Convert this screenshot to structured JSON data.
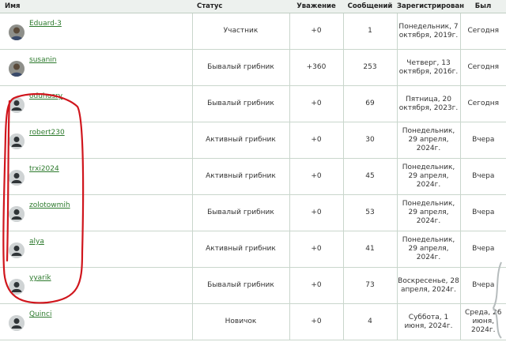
{
  "header": {
    "name": "Имя",
    "status": "Статус",
    "respect": "Уважение",
    "messages": "Сообщений",
    "registered": "Зарегистрирован",
    "last_seen": "Был"
  },
  "rows": [
    {
      "name": "Eduard-3",
      "status": "Участник",
      "respect": "+0",
      "messages": "1",
      "registered": "Понедельник, 7 октября, 2019г.",
      "last_seen": "Сегодня",
      "avatar": "photo-avatar"
    },
    {
      "name": "susanin",
      "status": "Бывалый грибник",
      "respect": "+360",
      "messages": "253",
      "registered": "Четверг, 13 октября, 2016г.",
      "last_seen": "Сегодня",
      "avatar": "photo-avatar"
    },
    {
      "name": "oduhusry",
      "status": "Бывалый грибник",
      "respect": "+0",
      "messages": "69",
      "registered": "Пятница, 20 октября, 2023г.",
      "last_seen": "Сегодня",
      "avatar": "default-user-icon"
    },
    {
      "name": "robert230",
      "status": "Активный грибник",
      "respect": "+0",
      "messages": "30",
      "registered": "Понедельник, 29 апреля, 2024г.",
      "last_seen": "Вчера",
      "avatar": "default-user-icon"
    },
    {
      "name": "trxi2024",
      "status": "Активный грибник",
      "respect": "+0",
      "messages": "45",
      "registered": "Понедельник, 29 апреля, 2024г.",
      "last_seen": "Вчера",
      "avatar": "default-user-icon"
    },
    {
      "name": "zolotowmih",
      "status": "Бывалый грибник",
      "respect": "+0",
      "messages": "53",
      "registered": "Понедельник, 29 апреля, 2024г.",
      "last_seen": "Вчера",
      "avatar": "default-user-icon"
    },
    {
      "name": "alya",
      "status": "Активный грибник",
      "respect": "+0",
      "messages": "41",
      "registered": "Понедельник, 29 апреля, 2024г.",
      "last_seen": "Вчера",
      "avatar": "default-user-icon"
    },
    {
      "name": "yyarik",
      "status": "Бывалый грибник",
      "respect": "+0",
      "messages": "73",
      "registered": "Воскресенье, 28 апреля, 2024г.",
      "last_seen": "Вчера",
      "avatar": "default-user-icon"
    },
    {
      "name": "Quinci",
      "status": "Новичок",
      "respect": "+0",
      "messages": "4",
      "registered": "Суббота, 1 июня, 2024г.",
      "last_seen": "Среда, 26 июня, 2024г.",
      "avatar": "default-user-icon"
    }
  ],
  "colors": {
    "username_link": "#2d7a2d",
    "header_bg": "#edf1ee",
    "grid_line": "#c9d6cc",
    "annotation_loop": "#d0161d"
  }
}
